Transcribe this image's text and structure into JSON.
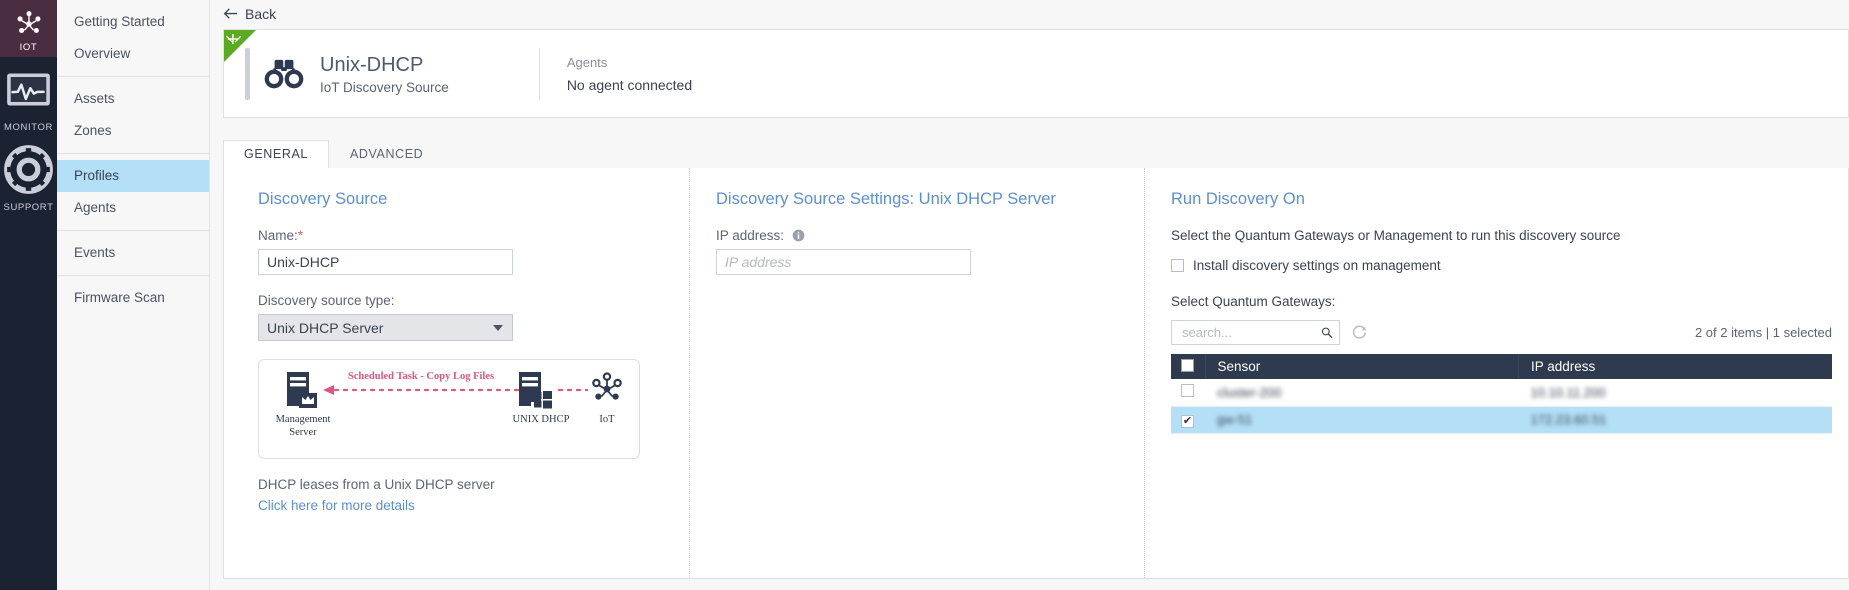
{
  "rail": {
    "items": [
      {
        "label": "IOT",
        "icon": "iot-hub-icon",
        "active": true
      },
      {
        "label": "MONITOR",
        "icon": "monitor-wave-icon",
        "active": false
      },
      {
        "label": "SUPPORT",
        "icon": "support-lifering-icon",
        "active": false
      }
    ]
  },
  "nav": {
    "groups": [
      {
        "items": [
          {
            "label": "Getting Started"
          },
          {
            "label": "Overview"
          }
        ]
      },
      {
        "items": [
          {
            "label": "Assets"
          },
          {
            "label": "Zones"
          }
        ]
      },
      {
        "items": [
          {
            "label": "Profiles",
            "active": true
          },
          {
            "label": "Agents"
          }
        ]
      },
      {
        "items": [
          {
            "label": "Events"
          }
        ]
      },
      {
        "items": [
          {
            "label": "Firmware Scan"
          }
        ]
      }
    ]
  },
  "back": {
    "label": "Back",
    "icon": "arrow-left-icon"
  },
  "header_card": {
    "title": "Unix-DHCP",
    "subtitle": "IoT Discovery Source",
    "icon": "binoculars-icon",
    "corner_icon": "sparkle-icon",
    "corner_color": "#5aab20",
    "agents_label": "Agents",
    "agents_value": "No agent connected"
  },
  "tabs": [
    {
      "label": "GENERAL",
      "active": true
    },
    {
      "label": "ADVANCED",
      "active": false
    }
  ],
  "discovery_source": {
    "title": "Discovery Source",
    "name_label": "Name:",
    "name_required": "*",
    "name_value": "Unix-DHCP",
    "type_label": "Discovery source type:",
    "type_value": "Unix DHCP Server",
    "helper_text": "DHCP leases from a Unix DHCP server",
    "link_text": "Click here for more details",
    "diagram": {
      "arrow_label": "Scheduled Task - Copy Log Files",
      "arrow_color": "#e0557f",
      "nodes": [
        {
          "label": "Management\nServer",
          "label_line1": "Management",
          "label_line2": "Server",
          "icon": "server-crown-icon"
        },
        {
          "label": "UNIX DHCP",
          "icon": "server-windows-icon"
        },
        {
          "label": "IoT",
          "icon": "iot-hub-icon"
        }
      ]
    }
  },
  "settings": {
    "title": "Discovery Source Settings: Unix DHCP Server",
    "ip_label": "IP address:",
    "ip_info_icon": "info-icon",
    "ip_value": "",
    "ip_placeholder": "IP address"
  },
  "run_discovery": {
    "title": "Run Discovery On",
    "description": "Select the Quantum Gateways or Management to run this discovery source",
    "install_checkbox_label": "Install discovery settings on management",
    "install_checked": false,
    "select_label": "Select Quantum Gateways:",
    "search_placeholder": "search...",
    "search_value": "",
    "search_icon": "search-icon",
    "refresh_icon": "refresh-icon",
    "count_text": "2 of 2 items | 1 selected",
    "table": {
      "columns": [
        "Sensor",
        "IP address"
      ],
      "header_checkbox_checked": false,
      "rows": [
        {
          "checked": false,
          "selected": false,
          "redacted": true,
          "sensor": "cluster-200",
          "ip": "10.10.11.200"
        },
        {
          "checked": true,
          "selected": true,
          "redacted": true,
          "sensor": "gw-51",
          "ip": "172.23.60.51"
        }
      ]
    }
  }
}
